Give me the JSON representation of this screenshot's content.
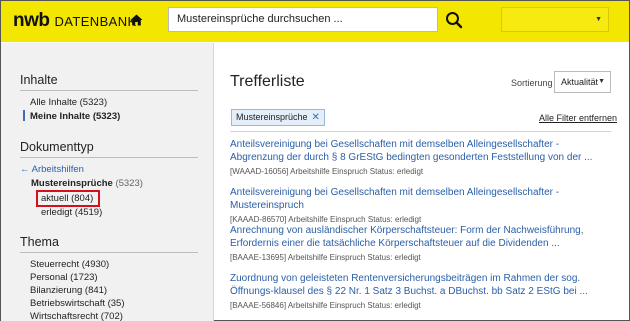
{
  "header": {
    "logo_brand": "nwb",
    "logo_product": "DATENBANK",
    "search_value": "Mustereinsprüche durchsuchen ...",
    "icons": {
      "home": "home-icon",
      "search": "search-icon"
    },
    "colors": {
      "brand_yellow": "#f3e600",
      "link_blue": "#2a5fa8",
      "highlight_red": "#d4101a"
    }
  },
  "sidebar": {
    "inhalte_heading": "Inhalte",
    "inhalte": [
      {
        "label": "Alle Inhalte (5323)"
      },
      {
        "label": "Meine Inhalte (5323)"
      }
    ],
    "dokumenttyp_heading": "Dokumenttyp",
    "back_link": "Arbeitshilfen",
    "doc_group": {
      "label": "Mustereinsprüche",
      "count": "(5323)"
    },
    "doc_subitems": [
      {
        "label": "aktuell (804)"
      },
      {
        "label": "erledigt (4519)"
      }
    ],
    "thema_heading": "Thema",
    "thema": [
      {
        "label": "Steuerrecht (4930)"
      },
      {
        "label": "Personal (1723)"
      },
      {
        "label": "Bilanzierung (841)"
      },
      {
        "label": "Betriebswirtschaft (35)"
      },
      {
        "label": "Wirtschaftsrecht (702)"
      }
    ]
  },
  "main": {
    "title": "Trefferliste",
    "sort_label": "Sortierung",
    "sort_value": "Aktualität",
    "filter_chip": "Mustereinsprüche",
    "clear_filters": "Alle Filter entfernen",
    "results": [
      {
        "title": "Anteilsvereinigung bei Gesellschaften mit demselben Alleingesellschafter - Abgrenzung der durch § 8 GrEStG bedingten gesonderten Feststellung von der ...",
        "meta": "[WAAAD-16056] Arbeitshilfe Einspruch Status: erledigt"
      },
      {
        "title": "Anteilsvereinigung bei Gesellschaften mit demselben Alleingesellschafter - Mustereinspruch",
        "meta": "[KAAAD-86570] Arbeitshilfe Einspruch Status: erledigt"
      },
      {
        "title": "Anrechnung von ausländischer Körperschaftsteuer: Form der Nachweisführung, Erfordernis einer die tatsächliche Körperschaftsteuer auf die Dividenden ...",
        "meta": "[BAAAE-13695] Arbeitshilfe Einspruch Status: erledigt"
      },
      {
        "title": "Zuordnung von geleisteten Rentenversicherungsbeiträgen im Rahmen der sog. Öffnungs-klausel des § 22 Nr. 1 Satz 3 Buchst. a DBuchst. bb Satz 2 EStG bei ...",
        "meta": "[BAAAE-56846] Arbeitshilfe Einspruch Status: erledigt"
      }
    ]
  }
}
